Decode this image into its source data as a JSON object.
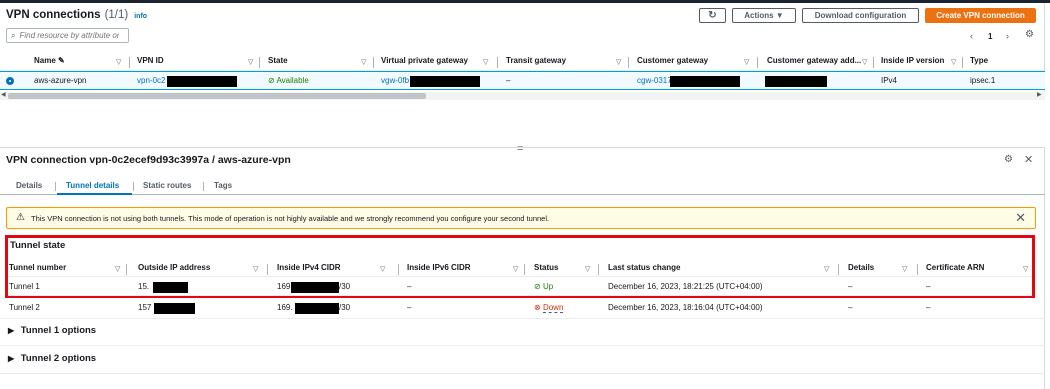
{
  "top": {
    "title": "VPN connections",
    "count": "(1/1)",
    "info": "info",
    "actions_label": "Actions ▼",
    "download_label": "Download configuration",
    "create_label": "Create VPN connection",
    "search_placeholder": "Find resource by attribute or tag",
    "page_number": "1",
    "columns": [
      "Name",
      "VPN ID",
      "State",
      "Virtual private gateway",
      "Transit gateway",
      "Customer gateway",
      "Customer gateway add...",
      "Inside IP version",
      "Type"
    ],
    "row": {
      "name": "aws-azure-vpn",
      "vpn_id": "vpn-0c2",
      "state": "Available",
      "vgw": "vgw-0fb",
      "transit": "–",
      "cgw": "cgw-0317",
      "ip_version": "IPv4",
      "type": "ipsec.1"
    }
  },
  "detail": {
    "title": "VPN connection vpn-0c2ecef9d93c3997a / aws-azure-vpn",
    "tabs": [
      "Details",
      "Tunnel details",
      "Static routes",
      "Tags"
    ],
    "warning": "This VPN connection is not using both tunnels. This mode of operation is not highly available and we strongly recommend you configure your second tunnel.",
    "tunnel_state_title": "Tunnel state",
    "columns": [
      "Tunnel number",
      "Outside IP address",
      "Inside IPv4 CIDR",
      "Inside IPv6 CIDR",
      "Status",
      "Last status change",
      "Details",
      "Certificate ARN"
    ],
    "rows": [
      {
        "tunnel": "Tunnel 1",
        "outside_ip": "15.",
        "inside_v4_prefix": "169",
        "inside_v4_suffix": "/30",
        "inside_v6": "–",
        "status": "Up",
        "last_change": "December 16, 2023, 18:21:25 (UTC+04:00)",
        "details": "–",
        "cert": "–"
      },
      {
        "tunnel": "Tunnel 2",
        "outside_ip": "157",
        "inside_v4_prefix": "169.",
        "inside_v4_suffix": "/30",
        "inside_v6": "–",
        "status": "Down",
        "last_change": "December 16, 2023, 18:16:04 (UTC+04:00)",
        "details": "–",
        "cert": "–"
      }
    ],
    "options": [
      "Tunnel 1 options",
      "Tunnel 2 options"
    ]
  },
  "colors": {
    "accent": "#0073bb",
    "primary_button": "#ec7211",
    "highlight_box": "#e30613",
    "status_ok": "#1d8102",
    "status_down": "#d13212"
  }
}
